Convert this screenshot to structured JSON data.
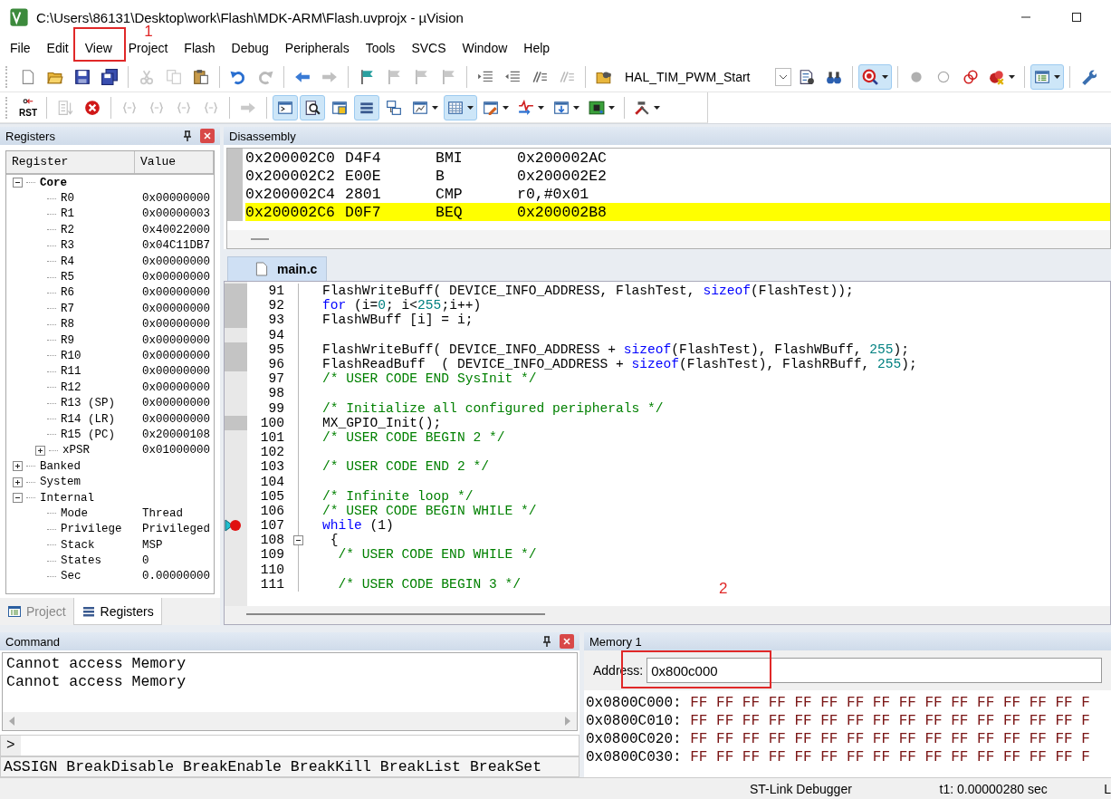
{
  "window": {
    "title": "C:\\Users\\86131\\Desktop\\work\\Flash\\MDK-ARM\\Flash.uvprojx - µVision"
  },
  "menu": {
    "annotation": "1",
    "items": [
      {
        "label": "File",
        "marked": false
      },
      {
        "label": "Edit",
        "marked": false
      },
      {
        "label": "View",
        "marked": true
      },
      {
        "label": "Project",
        "marked": false
      },
      {
        "label": "Flash",
        "marked": false
      },
      {
        "label": "Debug",
        "marked": false
      },
      {
        "label": "Peripherals",
        "marked": false
      },
      {
        "label": "Tools",
        "marked": false
      },
      {
        "label": "SVCS",
        "marked": false
      },
      {
        "label": "Window",
        "marked": false
      },
      {
        "label": "Help",
        "marked": false
      }
    ]
  },
  "toolbars": [
    {
      "items": [
        {
          "kind": "button",
          "on": false,
          "disabled": false
        },
        {
          "kind": "button",
          "on": false,
          "disabled": false
        },
        {
          "kind": "button",
          "on": false,
          "disabled": false
        },
        {
          "kind": "button",
          "on": false,
          "disabled": false
        },
        {
          "kind": "separator"
        },
        {
          "kind": "button",
          "on": false,
          "disabled": true
        },
        {
          "kind": "button",
          "on": false,
          "disabled": true
        },
        {
          "kind": "button",
          "on": false,
          "disabled": false
        },
        {
          "kind": "separator"
        },
        {
          "kind": "button",
          "on": false,
          "disabled": false
        },
        {
          "kind": "button",
          "on": false,
          "disabled": true
        },
        {
          "kind": "separator"
        },
        {
          "kind": "button",
          "on": false,
          "disabled": false
        },
        {
          "kind": "button",
          "on": false,
          "disabled": true
        },
        {
          "kind": "separator"
        },
        {
          "kind": "button",
          "on": false,
          "disabled": false
        },
        {
          "kind": "button",
          "on": false,
          "disabled": true
        },
        {
          "kind": "button",
          "on": false,
          "disabled": true
        },
        {
          "kind": "button",
          "on": false,
          "disabled": true
        },
        {
          "kind": "separator"
        },
        {
          "kind": "button",
          "on": false,
          "disabled": false
        },
        {
          "kind": "button",
          "on": false,
          "disabled": false
        },
        {
          "kind": "button",
          "on": false,
          "disabled": false
        },
        {
          "kind": "button",
          "on": false,
          "disabled": true
        },
        {
          "kind": "separator"
        },
        {
          "kind": "button",
          "on": false,
          "disabled": false
        },
        {
          "kind": "combo",
          "value": "HAL_TIM_PWM_Start"
        },
        {
          "kind": "button",
          "on": false,
          "disabled": false
        },
        {
          "kind": "button",
          "on": false,
          "disabled": false
        },
        {
          "kind": "separator"
        },
        {
          "kind": "dropdown",
          "on": true,
          "disabled": false
        },
        {
          "kind": "separator"
        },
        {
          "kind": "button",
          "on": false,
          "disabled": false
        },
        {
          "kind": "button",
          "on": false,
          "disabled": false
        },
        {
          "kind": "button",
          "on": false,
          "disabled": false
        },
        {
          "kind": "dropdown",
          "on": false,
          "disabled": false
        },
        {
          "kind": "separator"
        },
        {
          "kind": "dropdown",
          "on": true,
          "disabled": false
        },
        {
          "kind": "separator"
        },
        {
          "kind": "button",
          "on": false,
          "disabled": false
        }
      ]
    },
    {
      "items": [
        {
          "kind": "button",
          "on": false,
          "disabled": false,
          "label": "RST"
        },
        {
          "kind": "separator"
        },
        {
          "kind": "button",
          "on": false,
          "disabled": true
        },
        {
          "kind": "button",
          "on": false,
          "disabled": false
        },
        {
          "kind": "separator"
        },
        {
          "kind": "button",
          "on": false,
          "disabled": true
        },
        {
          "kind": "button",
          "on": false,
          "disabled": true
        },
        {
          "kind": "button",
          "on": false,
          "disabled": true
        },
        {
          "kind": "button",
          "on": false,
          "disabled": true
        },
        {
          "kind": "separator"
        },
        {
          "kind": "button",
          "on": false,
          "disabled": true
        },
        {
          "kind": "separator"
        },
        {
          "kind": "button",
          "on": true,
          "disabled": false
        },
        {
          "kind": "button",
          "on": true,
          "disabled": false
        },
        {
          "kind": "button",
          "on": false,
          "disabled": false
        },
        {
          "kind": "button",
          "on": true,
          "disabled": false
        },
        {
          "kind": "button",
          "on": false,
          "disabled": false
        },
        {
          "kind": "dropdown",
          "on": false,
          "disabled": false
        },
        {
          "kind": "dropdown",
          "on": true,
          "disabled": false
        },
        {
          "kind": "dropdown",
          "on": false,
          "disabled": false
        },
        {
          "kind": "dropdown",
          "on": false,
          "disabled": false
        },
        {
          "kind": "dropdown",
          "on": false,
          "disabled": false
        },
        {
          "kind": "dropdown",
          "on": false,
          "disabled": false
        },
        {
          "kind": "separator"
        },
        {
          "kind": "dropdown",
          "on": false,
          "disabled": false
        }
      ]
    }
  ],
  "registers": {
    "title": "Registers",
    "columns": [
      "Register",
      "Value"
    ],
    "tree": [
      {
        "name": "Core",
        "bold": true,
        "expanded": true,
        "children": [
          {
            "name": "R0",
            "value": "0x00000000"
          },
          {
            "name": "R1",
            "value": "0x00000003"
          },
          {
            "name": "R2",
            "value": "0x40022000"
          },
          {
            "name": "R3",
            "value": "0x04C11DB7"
          },
          {
            "name": "R4",
            "value": "0x00000000"
          },
          {
            "name": "R5",
            "value": "0x00000000"
          },
          {
            "name": "R6",
            "value": "0x00000000"
          },
          {
            "name": "R7",
            "value": "0x00000000"
          },
          {
            "name": "R8",
            "value": "0x00000000"
          },
          {
            "name": "R9",
            "value": "0x00000000"
          },
          {
            "name": "R10",
            "value": "0x00000000"
          },
          {
            "name": "R11",
            "value": "0x00000000"
          },
          {
            "name": "R12",
            "value": "0x00000000"
          },
          {
            "name": "R13 (SP)",
            "value": "0x00000000"
          },
          {
            "name": "R14 (LR)",
            "value": "0x00000000"
          },
          {
            "name": "R15 (PC)",
            "value": "0x20000108"
          },
          {
            "name": "xPSR",
            "value": "0x01000000",
            "expanded": false
          }
        ]
      },
      {
        "name": "Banked",
        "bold": false,
        "expanded": false
      },
      {
        "name": "System",
        "bold": false,
        "expanded": false
      },
      {
        "name": "Internal",
        "bold": false,
        "expanded": true,
        "children": [
          {
            "name": "Mode",
            "value": "Thread"
          },
          {
            "name": "Privilege",
            "value": "Privileged"
          },
          {
            "name": "Stack",
            "value": "MSP"
          },
          {
            "name": "States",
            "value": "0"
          },
          {
            "name": "Sec",
            "value": "0.00000000"
          }
        ]
      }
    ],
    "tabs": [
      {
        "label": "Project",
        "selected": false
      },
      {
        "label": "Registers",
        "selected": true
      }
    ]
  },
  "disassembly": {
    "title": "Disassembly",
    "rows": [
      {
        "address": "0x200002C0",
        "opcode": "D4F4",
        "mnemonic": "BMI",
        "operand": "0x200002AC",
        "current": false
      },
      {
        "address": "0x200002C2",
        "opcode": "E00E",
        "mnemonic": "B",
        "operand": "0x200002E2",
        "current": false
      },
      {
        "address": "0x200002C4",
        "opcode": "2801",
        "mnemonic": "CMP",
        "operand": "r0,#0x01",
        "current": false
      },
      {
        "address": "0x200002C6",
        "opcode": "D0F7",
        "mnemonic": "BEQ",
        "operand": "0x200002B8",
        "current": true
      }
    ]
  },
  "editor": {
    "annotation": "2",
    "tabs": [
      {
        "label": "main.c",
        "selected": true
      }
    ],
    "lines": [
      {
        "number": "91",
        "marked": true,
        "breakpoint": false,
        "current": false,
        "segments": [
          {
            "kind": "plain",
            "text": "FlashWriteBuff( DEVICE_INFO_ADDRESS, FlashTest, "
          },
          {
            "kind": "keyword",
            "text": "sizeof"
          },
          {
            "kind": "plain",
            "text": "(FlashTest));"
          }
        ]
      },
      {
        "number": "92",
        "marked": true,
        "breakpoint": false,
        "current": false,
        "segments": [
          {
            "kind": "keyword",
            "text": "for"
          },
          {
            "kind": "plain",
            "text": " (i="
          },
          {
            "kind": "number",
            "text": "0"
          },
          {
            "kind": "plain",
            "text": "; i<"
          },
          {
            "kind": "number",
            "text": "255"
          },
          {
            "kind": "plain",
            "text": ";i++)"
          }
        ]
      },
      {
        "number": "93",
        "marked": true,
        "breakpoint": false,
        "current": false,
        "segments": [
          {
            "kind": "plain",
            "text": "FlashWBuff [i] = i;"
          }
        ]
      },
      {
        "number": "94",
        "marked": false,
        "breakpoint": false,
        "current": false
      },
      {
        "number": "95",
        "marked": true,
        "breakpoint": false,
        "current": false,
        "segments": [
          {
            "kind": "plain",
            "text": "FlashWriteBuff( DEVICE_INFO_ADDRESS + "
          },
          {
            "kind": "keyword",
            "text": "sizeof"
          },
          {
            "kind": "plain",
            "text": "(FlashTest), FlashWBuff, "
          },
          {
            "kind": "number",
            "text": "255"
          },
          {
            "kind": "plain",
            "text": ");"
          }
        ]
      },
      {
        "number": "96",
        "marked": true,
        "breakpoint": false,
        "current": false,
        "segments": [
          {
            "kind": "plain",
            "text": "FlashReadBuff  ( DEVICE_INFO_ADDRESS + "
          },
          {
            "kind": "keyword",
            "text": "sizeof"
          },
          {
            "kind": "plain",
            "text": "(FlashTest), FlashRBuff, "
          },
          {
            "kind": "number",
            "text": "255"
          },
          {
            "kind": "plain",
            "text": ");"
          }
        ]
      },
      {
        "number": "97",
        "marked": false,
        "breakpoint": false,
        "current": false,
        "segments": [
          {
            "kind": "comment",
            "text": "/* USER CODE END SysInit */"
          }
        ]
      },
      {
        "number": "98",
        "marked": false,
        "breakpoint": false,
        "current": false
      },
      {
        "number": "99",
        "marked": false,
        "breakpoint": false,
        "current": false,
        "segments": [
          {
            "kind": "comment",
            "text": "/* Initialize all configured peripherals */"
          }
        ]
      },
      {
        "number": "100",
        "marked": true,
        "breakpoint": false,
        "current": false,
        "segments": [
          {
            "kind": "plain",
            "text": "MX_GPIO_Init();"
          }
        ]
      },
      {
        "number": "101",
        "marked": false,
        "breakpoint": false,
        "current": false,
        "segments": [
          {
            "kind": "comment",
            "text": "/* USER CODE BEGIN 2 */"
          }
        ]
      },
      {
        "number": "102",
        "marked": false,
        "breakpoint": false,
        "current": false
      },
      {
        "number": "103",
        "marked": false,
        "breakpoint": false,
        "current": false,
        "segments": [
          {
            "kind": "comment",
            "text": "/* USER CODE END 2 */"
          }
        ]
      },
      {
        "number": "104",
        "marked": false,
        "breakpoint": false,
        "current": false
      },
      {
        "number": "105",
        "marked": false,
        "breakpoint": false,
        "current": false,
        "segments": [
          {
            "kind": "comment",
            "text": "/* Infinite loop */"
          }
        ]
      },
      {
        "number": "106",
        "marked": false,
        "breakpoint": false,
        "current": false,
        "segments": [
          {
            "kind": "comment",
            "text": "/* USER CODE BEGIN WHILE */"
          }
        ]
      },
      {
        "number": "107",
        "marked": false,
        "breakpoint": true,
        "current": true,
        "segments": [
          {
            "kind": "keyword",
            "text": "while"
          },
          {
            "kind": "plain",
            "text": " (1)"
          }
        ]
      },
      {
        "number": "108",
        "marked": false,
        "breakpoint": false,
        "current": false,
        "fold_start": true,
        "segments": [
          {
            "kind": "plain",
            "text": " {"
          }
        ]
      },
      {
        "number": "109",
        "marked": false,
        "breakpoint": false,
        "current": false,
        "segments": [
          {
            "kind": "comment",
            "text": "  /* USER CODE END WHILE */"
          }
        ]
      },
      {
        "number": "110",
        "marked": false,
        "breakpoint": false,
        "current": false
      },
      {
        "number": "111",
        "marked": false,
        "breakpoint": false,
        "current": false,
        "segments": [
          {
            "kind": "comment",
            "text": "  /* USER CODE BEGIN 3 */"
          }
        ]
      }
    ]
  },
  "command": {
    "title": "Command",
    "output": [
      "Cannot access Memory",
      "Cannot access Memory"
    ],
    "prompt": ">",
    "help": "ASSIGN BreakDisable BreakEnable BreakKill BreakList BreakSet"
  },
  "memory": {
    "title": "Memory 1",
    "address_label": "Address:",
    "address": "0x800c000",
    "address_marked": true,
    "rows": [
      {
        "address": "0x0800C000:",
        "data": "FF FF FF FF FF FF FF FF FF FF FF FF FF FF FF F"
      },
      {
        "address": "0x0800C010:",
        "data": "FF FF FF FF FF FF FF FF FF FF FF FF FF FF FF F"
      },
      {
        "address": "0x0800C020:",
        "data": "FF FF FF FF FF FF FF FF FF FF FF FF FF FF FF F"
      },
      {
        "address": "0x0800C030:",
        "data": "FF FF FF FF FF FF FF FF FF FF FF FF FF FF FF F"
      }
    ]
  },
  "status_bar": {
    "items": [
      "ST-Link Debugger",
      "t1: 0.00000280 sec",
      "L"
    ]
  }
}
